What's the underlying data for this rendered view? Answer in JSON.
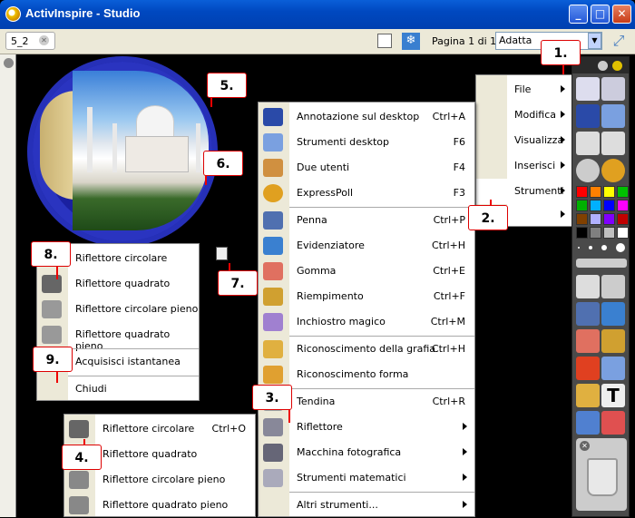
{
  "window": {
    "title": "ActivInspire - Studio",
    "minimize": "_",
    "maximize": "□",
    "close": "✕"
  },
  "toolbar": {
    "tab_label": "5_2",
    "page_label": "Pagina 1 di 1",
    "zoom_value": "Adatta"
  },
  "top_menu": {
    "items": [
      {
        "label": "File"
      },
      {
        "label": "Modifica"
      },
      {
        "label": "Visualizza"
      },
      {
        "label": "Inserisci"
      },
      {
        "label": "Strumenti"
      }
    ]
  },
  "tools_menu": {
    "items": [
      {
        "label": "Annotazione sul desktop",
        "shortcut": "Ctrl+A",
        "icon": "desktop-annotation-icon"
      },
      {
        "label": "Strumenti desktop",
        "shortcut": "F6",
        "icon": "desktop-tools-icon"
      },
      {
        "label": "Due utenti",
        "shortcut": "F4",
        "icon": "dual-user-icon"
      },
      {
        "label": "ExpressPoll",
        "shortcut": "F3",
        "icon": "expresspoll-icon"
      },
      {
        "label": "Penna",
        "shortcut": "Ctrl+P",
        "icon": "pen-icon"
      },
      {
        "label": "Evidenziatore",
        "shortcut": "Ctrl+H",
        "icon": "highlighter-icon"
      },
      {
        "label": "Gomma",
        "shortcut": "Ctrl+E",
        "icon": "eraser-icon"
      },
      {
        "label": "Riempimento",
        "shortcut": "Ctrl+F",
        "icon": "fill-icon"
      },
      {
        "label": "Inchiostro magico",
        "shortcut": "Ctrl+M",
        "icon": "magic-ink-icon"
      },
      {
        "label": "Riconoscimento della grafia",
        "shortcut": "Ctrl+H",
        "icon": "handwriting-icon"
      },
      {
        "label": "Riconoscimento forma",
        "shortcut": "",
        "icon": "shape-recognition-icon"
      },
      {
        "label": "Tendina",
        "shortcut": "Ctrl+R",
        "icon": "revealer-icon"
      },
      {
        "label": "Riflettore",
        "shortcut": "",
        "icon": "spotlight-icon"
      },
      {
        "label": "Macchina fotografica",
        "shortcut": "",
        "icon": "camera-icon"
      },
      {
        "label": "Strumenti matematici",
        "shortcut": "",
        "icon": "calculator-icon"
      },
      {
        "label": "Altri strumenti...",
        "shortcut": "",
        "icon": ""
      }
    ]
  },
  "spotlight_popup": {
    "items": [
      {
        "label": "Riflettore circolare"
      },
      {
        "label": "Riflettore quadrato"
      },
      {
        "label": "Riflettore circolare pieno"
      },
      {
        "label": "Riflettore quadrato pieno"
      },
      {
        "label": "Acquisisci istantanea"
      },
      {
        "label": "Chiudi"
      }
    ]
  },
  "spotlight_submenu": {
    "items": [
      {
        "label": "Riflettore circolare",
        "shortcut": "Ctrl+O"
      },
      {
        "label": "Riflettore quadrato",
        "shortcut": ""
      },
      {
        "label": "Riflettore circolare pieno",
        "shortcut": ""
      },
      {
        "label": "Riflettore quadrato pieno",
        "shortcut": ""
      }
    ]
  },
  "callouts": [
    "1.",
    "2.",
    "3.",
    "4.",
    "5.",
    "6.",
    "7.",
    "8.",
    "9."
  ],
  "colors": {
    "palette": [
      "#ff0000",
      "#ff8000",
      "#ffff00",
      "#00c000",
      "#00b000",
      "#00b0ff",
      "#0000ff",
      "#ff00ff",
      "#804000",
      "#b0b0ff",
      "#8000ff",
      "#c00000",
      "#000000",
      "#808080",
      "#c0c0c0",
      "#ffffff"
    ]
  }
}
